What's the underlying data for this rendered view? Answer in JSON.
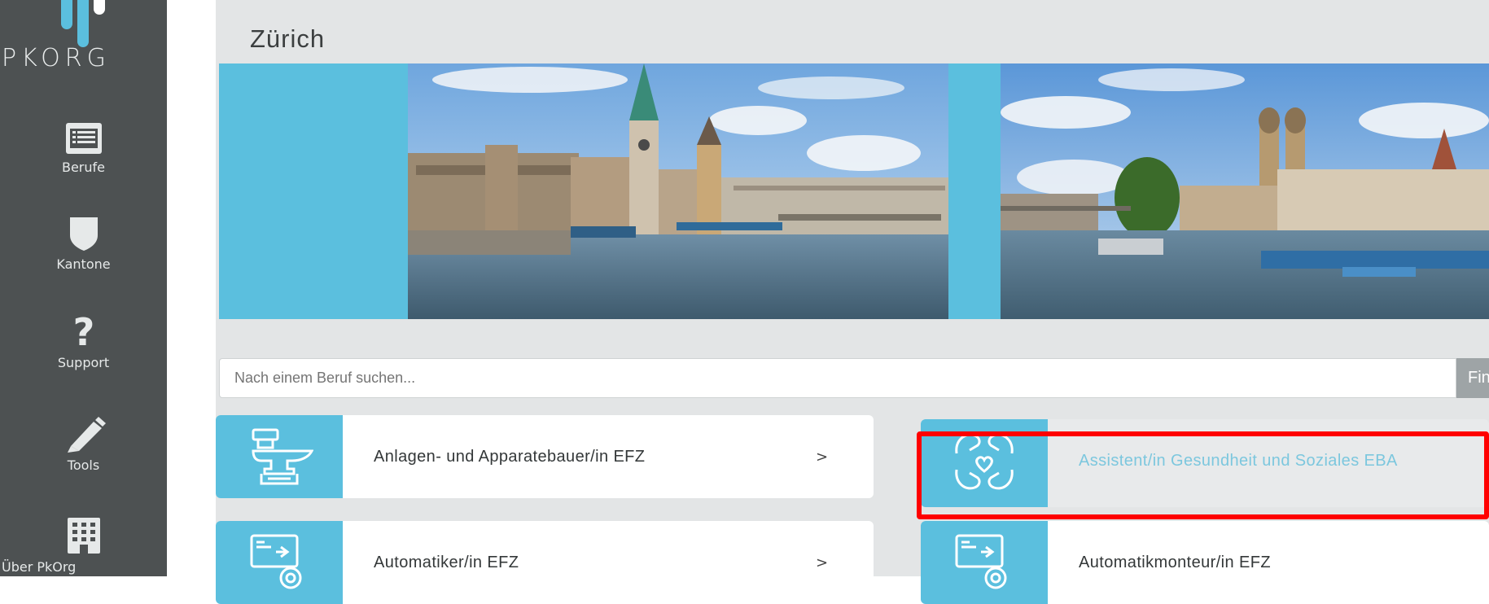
{
  "sidebar": {
    "logo_text": "PKORG",
    "items": [
      {
        "label": "Berufe",
        "icon": "list-icon"
      },
      {
        "label": "Kantone",
        "icon": "shield-icon"
      },
      {
        "label": "Support",
        "icon": "question-icon"
      },
      {
        "label": "Tools",
        "icon": "pencil-icon"
      },
      {
        "label": "Über PkOrg",
        "icon": "building-icon"
      }
    ]
  },
  "page": {
    "title": "Zürich"
  },
  "search": {
    "placeholder": "Nach einem Beruf suchen...",
    "button_label": "Finden"
  },
  "cards": [
    {
      "label": "Anlagen- und Apparatebauer/in EFZ",
      "chevron": ">",
      "icon": "anvil-icon"
    },
    {
      "label": "Assistent/in Gesundheit und Soziales EBA",
      "chevron": ">",
      "icon": "caring-hands-heart-icon",
      "highlighted": true
    },
    {
      "label": "Automatiker/in EFZ",
      "chevron": ">",
      "icon": "automation-monitor-gear-icon"
    },
    {
      "label": "Automatikmonteur/in EFZ",
      "chevron": ">",
      "icon": "automation-monitor-gear-icon"
    }
  ],
  "colors": {
    "sidebar_bg": "#4d5152",
    "accent": "#5bbfde",
    "content_bg": "#e3e5e6",
    "highlight_frame": "#ff0000"
  }
}
